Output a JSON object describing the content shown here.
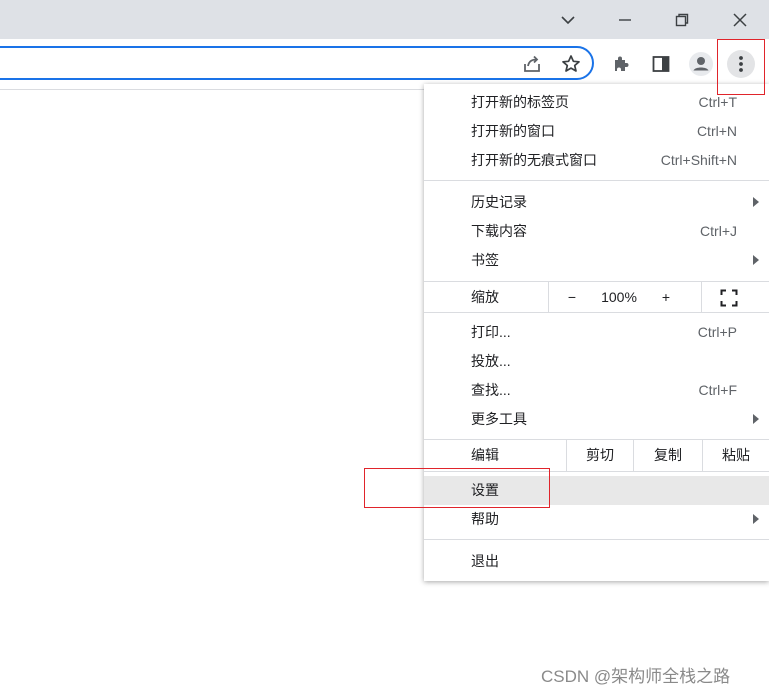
{
  "window": {
    "icons": [
      "chevron-down-icon",
      "minimize-icon",
      "restore-icon",
      "close-icon"
    ]
  },
  "toolbar": {
    "icons": [
      "share-icon",
      "bookmark-star-icon",
      "extensions-icon",
      "side-panel-icon",
      "profile-icon",
      "more-menu-icon"
    ]
  },
  "menu": {
    "new_tab": {
      "label": "打开新的标签页",
      "shortcut": "Ctrl+T"
    },
    "new_window": {
      "label": "打开新的窗口",
      "shortcut": "Ctrl+N"
    },
    "new_incognito": {
      "label": "打开新的无痕式窗口",
      "shortcut": "Ctrl+Shift+N"
    },
    "history": {
      "label": "历史记录"
    },
    "downloads": {
      "label": "下载内容",
      "shortcut": "Ctrl+J"
    },
    "bookmarks": {
      "label": "书签"
    },
    "zoom": {
      "label": "缩放",
      "minus": "−",
      "value": "100%",
      "plus": "+"
    },
    "print": {
      "label": "打印...",
      "shortcut": "Ctrl+P"
    },
    "cast": {
      "label": "投放..."
    },
    "find": {
      "label": "查找...",
      "shortcut": "Ctrl+F"
    },
    "more_tools": {
      "label": "更多工具"
    },
    "edit": {
      "label": "编辑",
      "cut": "剪切",
      "copy": "复制",
      "paste": "粘贴"
    },
    "settings": {
      "label": "设置"
    },
    "help": {
      "label": "帮助"
    },
    "exit": {
      "label": "退出"
    }
  },
  "annotation": {
    "color": "#e0242b"
  },
  "watermark": "CSDN @架构师全栈之路"
}
